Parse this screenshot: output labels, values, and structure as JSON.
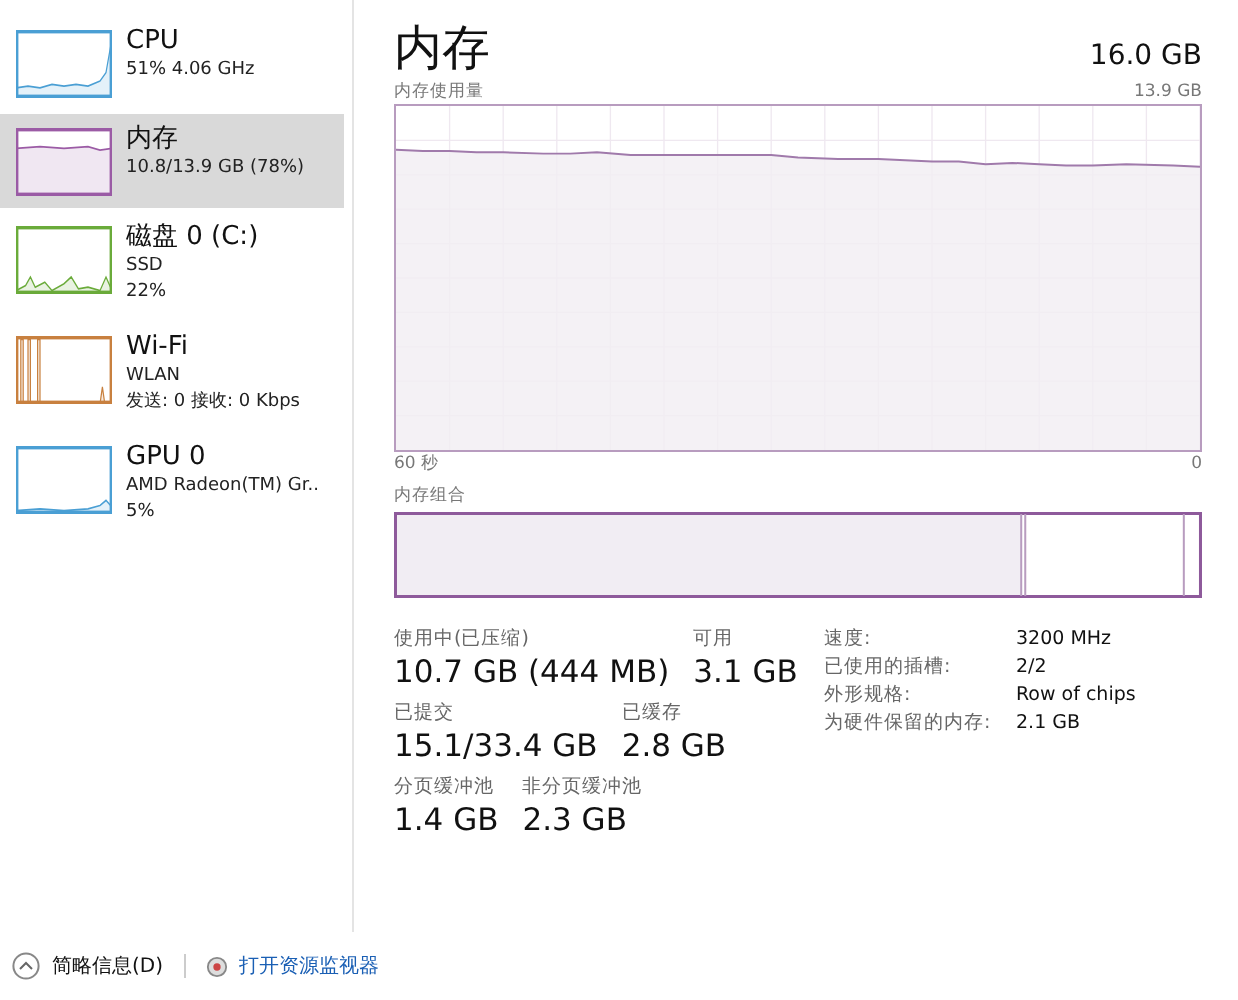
{
  "sidebar": {
    "items": [
      {
        "title": "CPU",
        "lines": [
          "51% 4.06 GHz"
        ],
        "color": "#4a9fd4",
        "selected": false
      },
      {
        "title": "内存",
        "lines": [
          "10.8/13.9 GB (78%)"
        ],
        "color": "#9b5ba5",
        "selected": true
      },
      {
        "title": "磁盘 0 (C:)",
        "lines": [
          "SSD",
          "22%"
        ],
        "color": "#6aab3a",
        "selected": false
      },
      {
        "title": "Wi-Fi",
        "lines": [
          "WLAN",
          "发送: 0 接收: 0 Kbps"
        ],
        "color": "#c8803f",
        "selected": false
      },
      {
        "title": "GPU 0",
        "lines": [
          "AMD Radeon(TM) Gr..",
          "5%"
        ],
        "color": "#4a9fd4",
        "selected": false
      }
    ]
  },
  "header": {
    "title": "内存",
    "total": "16.0 GB"
  },
  "usage_graph": {
    "label": "内存使用量",
    "max": "13.9 GB",
    "x_start": "60 秒",
    "x_end": "0"
  },
  "composition": {
    "label": "内存组合"
  },
  "stats": [
    [
      {
        "label": "使用中(已压缩)",
        "value": "10.7 GB (444 MB)"
      },
      {
        "label": "可用",
        "value": "3.1 GB"
      }
    ],
    [
      {
        "label": "已提交",
        "value": "15.1/33.4 GB"
      },
      {
        "label": "已缓存",
        "value": "2.8 GB"
      }
    ],
    [
      {
        "label": "分页缓冲池",
        "value": "1.4 GB"
      },
      {
        "label": "非分页缓冲池",
        "value": "2.3 GB"
      }
    ]
  ],
  "details": [
    {
      "label": "速度:",
      "value": "3200 MHz"
    },
    {
      "label": "已使用的插槽:",
      "value": "2/2"
    },
    {
      "label": "外形规格:",
      "value": "Row of chips"
    },
    {
      "label": "为硬件保留的内存:",
      "value": "2.1 GB"
    }
  ],
  "footer": {
    "summary": "简略信息(D)",
    "link": "打开资源监视器"
  }
}
